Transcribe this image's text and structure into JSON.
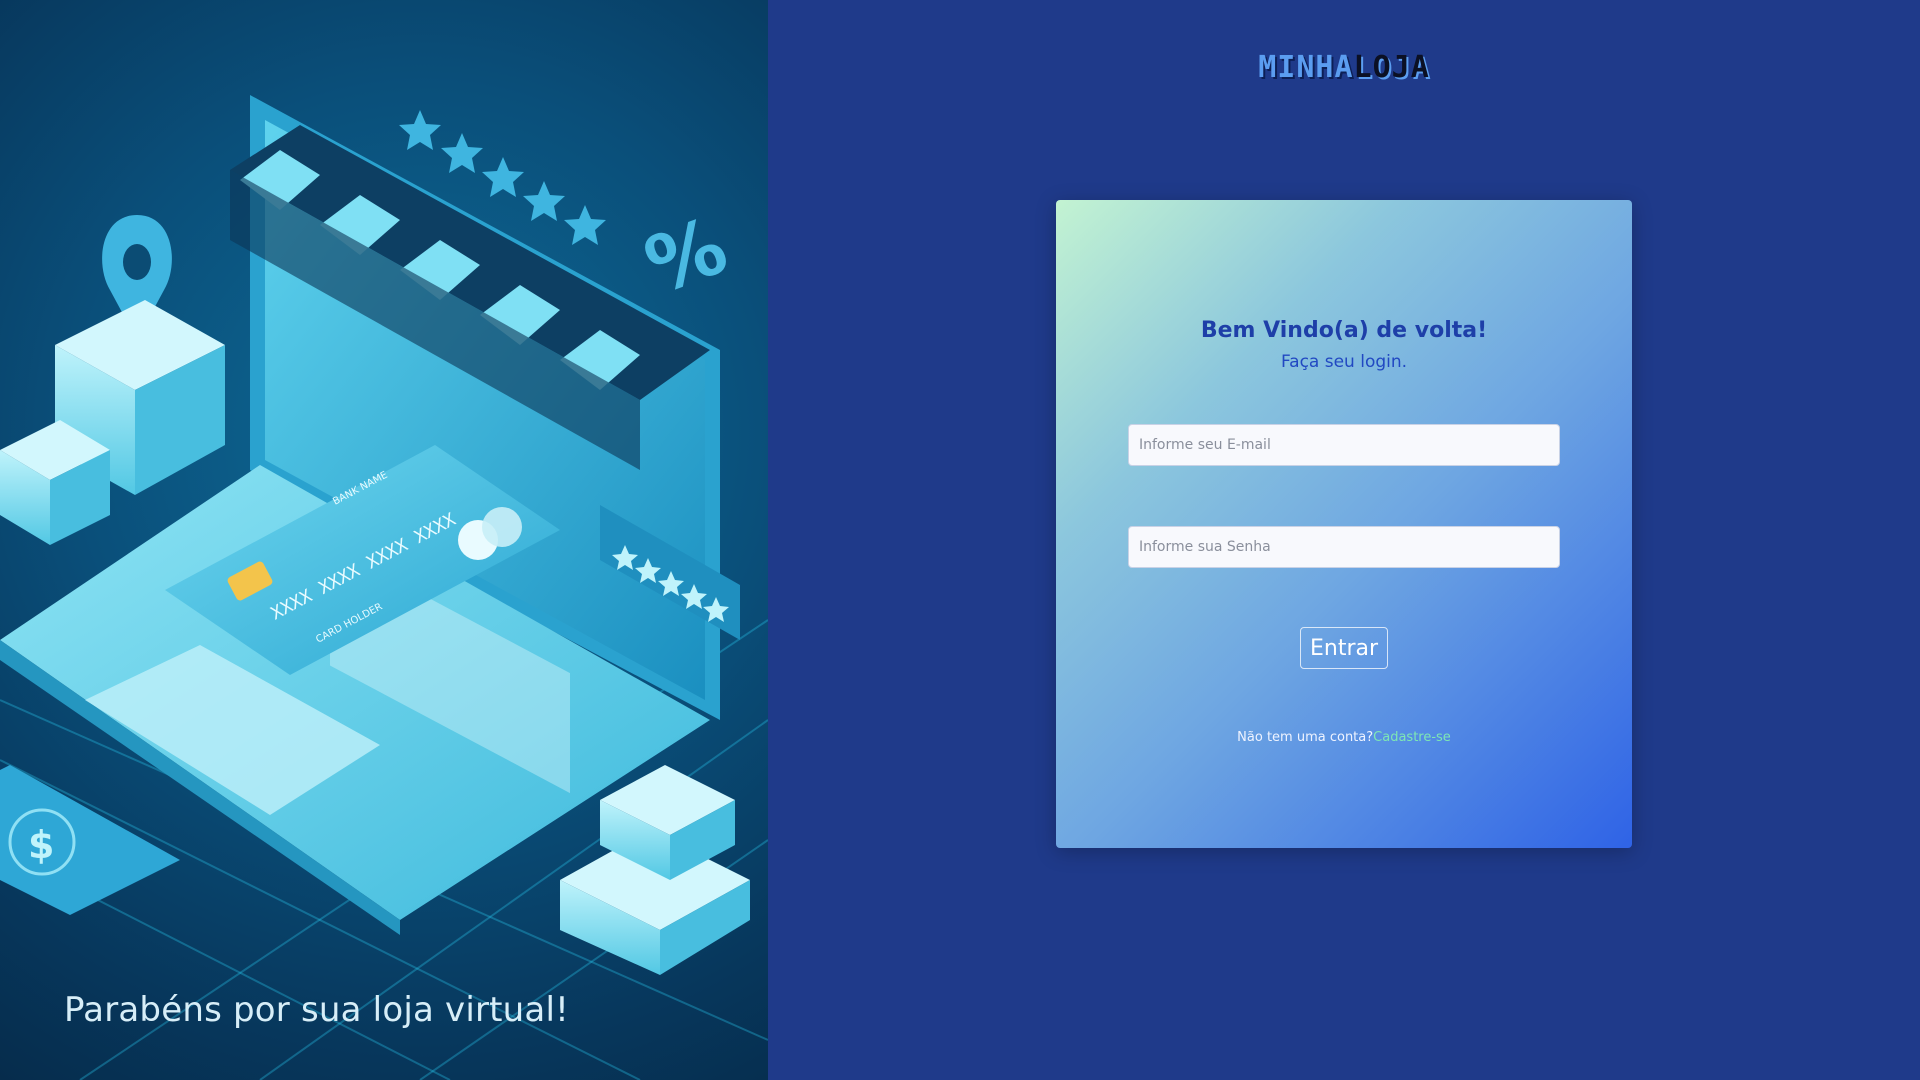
{
  "brand": {
    "part1": "MINHA",
    "part2": "LOJA"
  },
  "illustration": {
    "tagline": "Parabéns por sua loja virtual!",
    "card_number": "XXXX XXXX XXXX XXXX",
    "card_bank": "BANK NAME",
    "card_holder": "CARD HOLDER",
    "percent": "%",
    "dollar": "$"
  },
  "login": {
    "title": "Bem Vindo(a) de volta!",
    "subtitle": "Faça seu login.",
    "email_placeholder": "Informe seu E-mail",
    "email_value": "",
    "password_placeholder": "Informe sua Senha",
    "password_value": "",
    "submit_label": "Entrar",
    "signup_prompt": "Não tem uma conta?",
    "signup_link": "Cadastre-se"
  },
  "colors": {
    "right_bg": "#1f3a8a",
    "title": "#1e3fa8",
    "link": "#7ee7b4"
  }
}
